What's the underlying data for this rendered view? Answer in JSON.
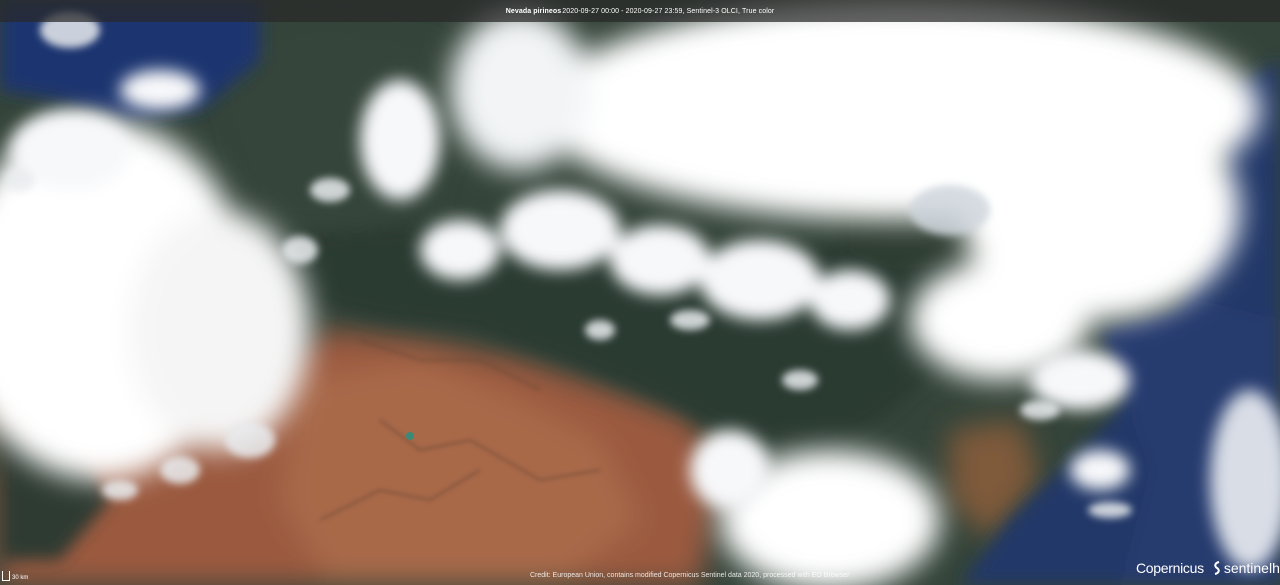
{
  "header": {
    "layer_name": "Nevada pirineos",
    "date_range": "2020-09-27 00:00 - 2020-09-27 23:59",
    "sensor": "Sentinel-3 OLCI",
    "visualization": "True color"
  },
  "footer": {
    "credit": "Credit: European Union, contains modified Copernicus Sentinel data 2020, processed with EO Browser",
    "scale_label": "30 km",
    "logo_copernicus": "Copernicus",
    "logo_sentinelhub": "sentinelhub"
  },
  "colors": {
    "vegetation": "#2f3d33",
    "soil": "#9a5a3f",
    "sea": "#22356b",
    "cloud": "#ffffff",
    "topbar": "#2a2a2a"
  }
}
